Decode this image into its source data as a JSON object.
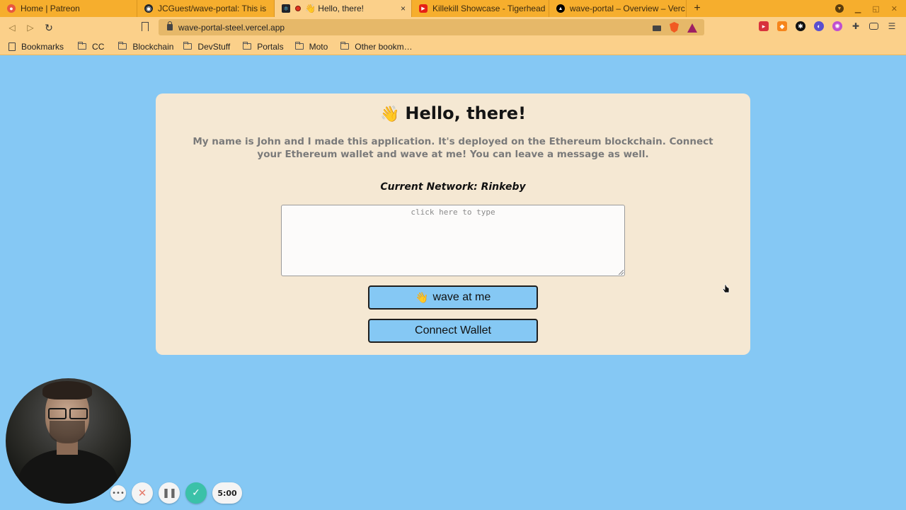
{
  "browser": {
    "tabs": [
      {
        "title": "Home | Patreon",
        "favicon": "patreon-icon",
        "active": false
      },
      {
        "title": "JCGuest/wave-portal: This is",
        "favicon": "github-icon",
        "active": false
      },
      {
        "title": "👋 Hello, there!",
        "favicon": "react-icon",
        "active": true,
        "close": "×"
      },
      {
        "title": "Killekill Showcase - Tigerhead",
        "favicon": "youtube-icon",
        "active": false
      },
      {
        "title": "wave-portal – Overview – Verc",
        "favicon": "vercel-icon",
        "active": false
      }
    ],
    "new_tab": "+",
    "url": "wave-portal-steel.vercel.app",
    "bookmarks": [
      "Bookmarks",
      "CC",
      "Blockchain",
      "DevStuff",
      "Portals",
      "Moto",
      "Other bookm…"
    ],
    "theme_color": "#f6ae2d"
  },
  "page": {
    "title_emoji": "👋",
    "title": "Hello, there!",
    "intro": "My name is John and I made this application. It's deployed on the Ethereum blockchain. Connect your Ethereum wallet and wave at me! You can leave a message as well.",
    "network_label": "Current Network: Rinkeby",
    "message": {
      "placeholder": "click here to type",
      "value": ""
    },
    "wave_button": {
      "emoji": "👋",
      "label": "wave at me"
    },
    "connect_button": {
      "label": "Connect Wallet"
    },
    "background_color": "#85c8f4",
    "card_color": "#f5e8d3"
  },
  "recorder": {
    "timer": "5:00",
    "controls": [
      "more-icon",
      "cancel-icon",
      "pause-icon",
      "check-icon"
    ]
  }
}
